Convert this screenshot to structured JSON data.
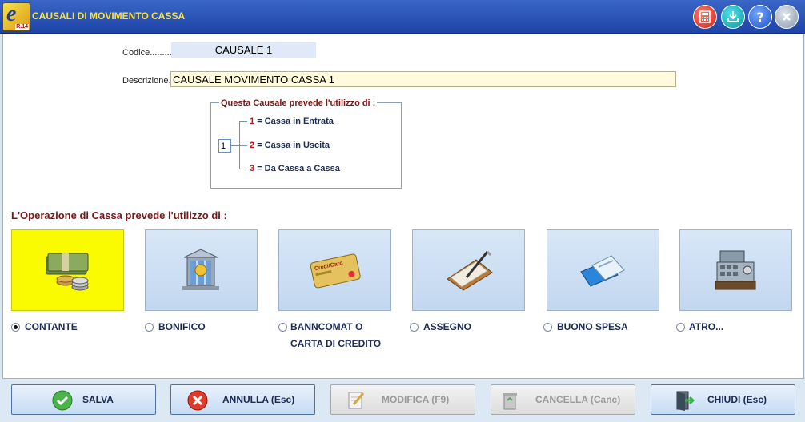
{
  "window": {
    "title": "CAUSALI DI MOVIMENTO CASSA",
    "logo_letter": "e",
    "logo_badge": "R.14",
    "controls": [
      "calculator-icon",
      "download-icon",
      "help-icon",
      "close-icon"
    ]
  },
  "form": {
    "codice_label": "Codice.........",
    "codice_value": "CAUSALE 1",
    "descrizione_label": "Descrizione..",
    "descrizione_value": "CAUSALE MOVIMENTO CASSA 1"
  },
  "tipo_group": {
    "title": "Questa Causale prevede l'utilizzo di :",
    "value": "1",
    "options": [
      {
        "num": "1",
        "text": "= Cassa in Entrata"
      },
      {
        "num": "2",
        "text": "= Cassa in Uscita"
      },
      {
        "num": "3",
        "text": "= Da Cassa a Cassa"
      }
    ]
  },
  "payment": {
    "title": "L'Operazione di Cassa prevede l'utilizzo di :",
    "selected": "CONTANTE",
    "methods": [
      {
        "label": "CONTANTE",
        "icon": "cash-icon",
        "selected": true
      },
      {
        "label": "BONIFICO",
        "icon": "bank-icon",
        "selected": false
      },
      {
        "label": "BANNCOMAT O",
        "label2": "CARTA DI CREDITO",
        "icon": "credit-card-icon",
        "card_text": "CreditCard",
        "selected": false
      },
      {
        "label": "ASSEGNO",
        "icon": "cheque-icon",
        "selected": false
      },
      {
        "label": "BUONO SPESA",
        "icon": "voucher-icon",
        "selected": false
      },
      {
        "label": "ATRO...",
        "icon": "cash-register-icon",
        "selected": false
      }
    ]
  },
  "buttons": [
    {
      "label": "SALVA",
      "icon": "check-icon",
      "enabled": true
    },
    {
      "label": "ANNULLA (Esc)",
      "icon": "cancel-icon",
      "enabled": true
    },
    {
      "label": "MODIFICA  (F9)",
      "icon": "edit-icon",
      "enabled": false
    },
    {
      "label": "CANCELLA  (Canc)",
      "icon": "trash-icon",
      "enabled": false
    },
    {
      "label": "CHIUDI  (Esc)",
      "icon": "exit-door-icon",
      "enabled": true
    }
  ],
  "colors": {
    "title_bar": "#2b55b8",
    "title_text": "#f7e23a",
    "accent_red": "#7a1616",
    "selected_tile": "#fbfb00",
    "tile": "#cbdcf2"
  }
}
